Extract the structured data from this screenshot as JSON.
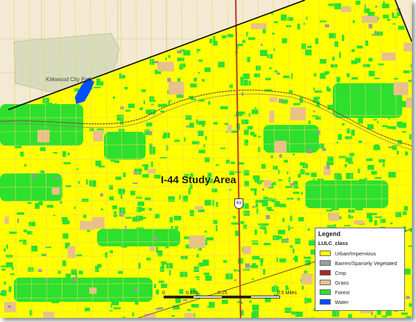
{
  "map": {
    "title": "I-44 Study Area",
    "park_label": "Kirkwood City Park",
    "highway_shield": "61"
  },
  "legend": {
    "title": "Legend",
    "field": "LULC_class",
    "items": [
      {
        "label": "Urban/Impervious",
        "color": "#ffff00"
      },
      {
        "label": "Barren/Sparsely Vegetated",
        "color": "#9c9c9c"
      },
      {
        "label": "Crop",
        "color": "#a52a2a"
      },
      {
        "label": "Grass",
        "color": "#e8c08a"
      },
      {
        "label": "Forest",
        "color": "#2ee02e"
      },
      {
        "label": "Water",
        "color": "#0050ff"
      }
    ]
  },
  "scale": {
    "labels": [
      "0",
      "0.125",
      "0.25",
      "0.5 Miles"
    ]
  },
  "colors": {
    "background": "#f4ead3",
    "study_boundary": "#111111",
    "highway": "#c0402a",
    "railroad": "#6b4a2a",
    "park_fill": "#d8dcbc"
  }
}
